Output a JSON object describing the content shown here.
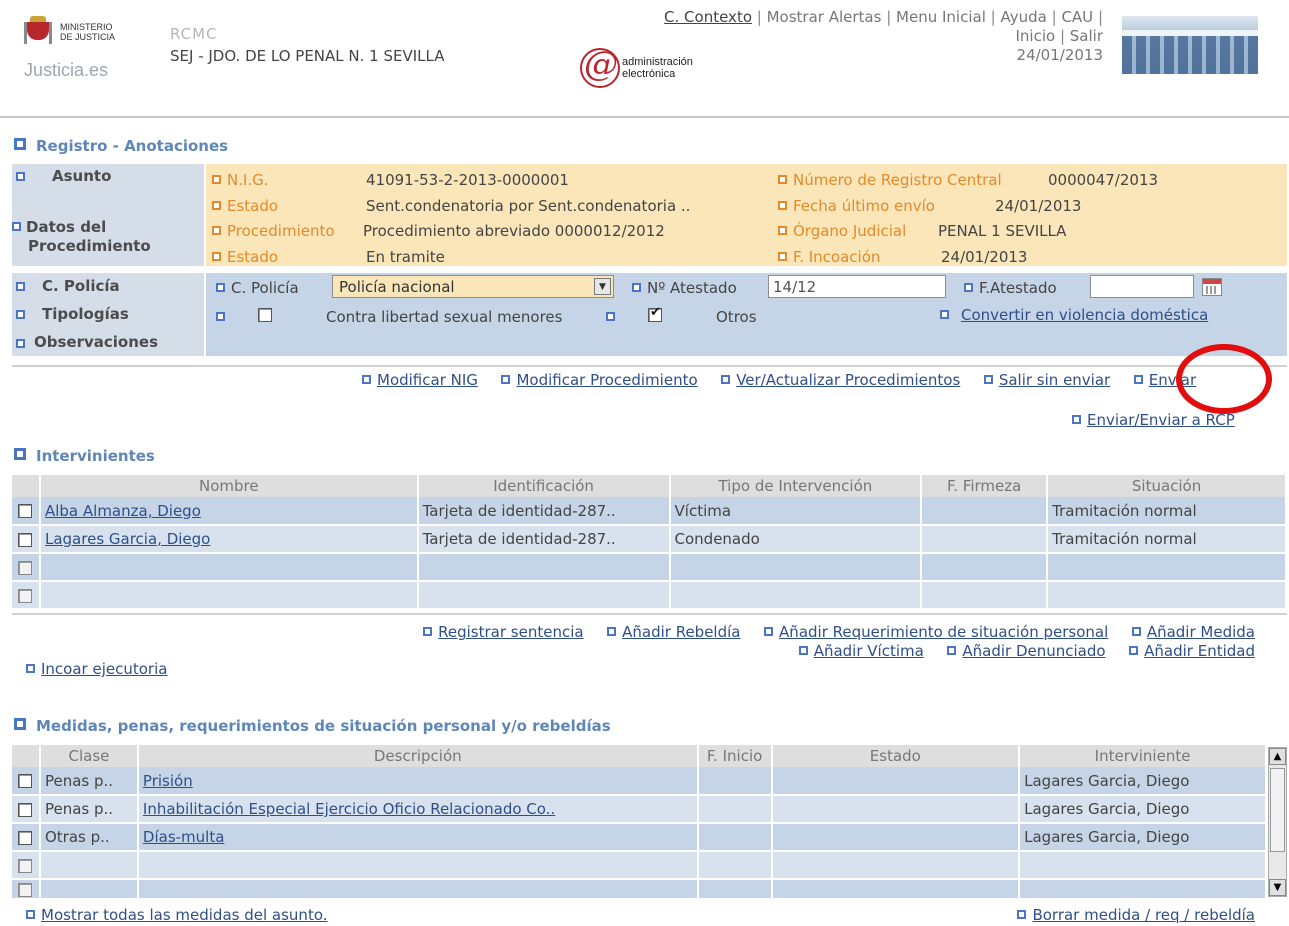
{
  "header": {
    "ministry_line1": "MINISTERIO",
    "ministry_line2": "DE JUSTICIA",
    "justicia_brand": "Justicia.es",
    "app_code": "RCMC",
    "court": "SEJ - JDO. DE LO PENAL N. 1 SEVILLA",
    "ae_line1": "administración",
    "ae_line2": "electrónica",
    "nav": {
      "contexto": "C. Contexto",
      "alertas": "Mostrar Alertas",
      "menu": "Menu Inicial",
      "ayuda": "Ayuda",
      "cau": "CAU",
      "inicio": "Inicio",
      "salir": "Salir",
      "date": "24/01/2013"
    }
  },
  "registro": {
    "title": "Registro - Anotaciones",
    "asunto_label": "Asunto",
    "datos_label_1": "Datos del",
    "datos_label_2": "Procedimiento",
    "nig_label": "N.I.G.",
    "nig_value": "41091-53-2-2013-0000001",
    "estado1_label": "Estado",
    "estado1_value": "Sent.condenatoria por Sent.condenatoria ..",
    "proc_label": "Procedimiento",
    "proc_value": "Procedimiento abreviado 0000012/2012",
    "estado2_label": "Estado",
    "estado2_value": "En tramite",
    "nrc_label": "Número de Registro Central",
    "nrc_value": "0000047/2013",
    "fue_label": "Fecha último envío",
    "fue_value": "24/01/2013",
    "organo_label": "Órgano Judicial",
    "organo_value": "PENAL 1 SEVILLA",
    "fincoacion_label": "F. Incoación",
    "fincoacion_value": "24/01/2013",
    "cpolicia_row_label": "C. Policía",
    "cpolicia_field_label": "C. Policía",
    "cpolicia_selected": "Policía nacional",
    "atestado_label": "Nº Atestado",
    "atestado_value": "14/12",
    "fatestado_label": "F.Atestado",
    "tipologias_label": "Tipologías",
    "tip1_text": "Contra libertad sexual menores",
    "tip2_text": "Otros",
    "convertir_link": "Convertir en violencia doméstica",
    "observaciones_label": "Observaciones"
  },
  "actions1": {
    "modificar_nig": "Modificar NIG",
    "modificar_proc": "Modificar Procedimiento",
    "ver_actualizar": "Ver/Actualizar Procedimientos",
    "salir_sin_enviar": "Salir sin enviar",
    "enviar": "Enviar",
    "enviar_rcp": "Enviar/Enviar a RCP"
  },
  "intervinientes": {
    "title": "Intervinientes",
    "columns": [
      "Nombre",
      "Identificación",
      "Tipo de Intervención",
      "F. Firmeza",
      "Situación"
    ],
    "rows": [
      {
        "nombre": "Alba Almanza, Diego",
        "ident": "Tarjeta de identidad-287..",
        "tipo": "Víctima",
        "firmeza": "",
        "situacion": "Tramitación normal"
      },
      {
        "nombre": "Lagares Garcia, Diego",
        "ident": "Tarjeta de identidad-287..",
        "tipo": "Condenado",
        "firmeza": "",
        "situacion": "Tramitación normal"
      }
    ]
  },
  "actions2": {
    "registrar_sentencia": "Registrar sentencia",
    "anadir_rebeldia": "Añadir Rebeldía",
    "anadir_requerimiento": "Añadir Requerimiento de situación personal",
    "anadir_medida": "Añadir Medida",
    "anadir_victima": "Añadir Víctima",
    "anadir_denunciado": "Añadir Denunciado",
    "anadir_entidad": "Añadir Entidad",
    "incoar_ejecutoria": "Incoar ejecutoria"
  },
  "medidas": {
    "title": "Medidas, penas, requerimientos de situación personal y/o rebeldías",
    "columns": [
      "Clase",
      "Descripción",
      "F. Inicio",
      "Estado",
      "Interviniente"
    ],
    "rows": [
      {
        "clase": "Penas p..",
        "desc": "Prisión",
        "inicio": "",
        "estado": "",
        "interv": "Lagares Garcia, Diego"
      },
      {
        "clase": "Penas p..",
        "desc": "Inhabilitación Especial Ejercicio Oficio Relacionado Co..",
        "inicio": "",
        "estado": "",
        "interv": "Lagares Garcia, Diego"
      },
      {
        "clase": "Otras p..",
        "desc": "Días-multa",
        "inicio": "",
        "estado": "",
        "interv": "Lagares Garcia, Diego"
      }
    ],
    "mostrar_todas": "Mostrar todas las medidas del asunto.",
    "borrar": "Borrar medida / req / rebeldía"
  },
  "colors": {
    "accent_blue": "#5e87b8",
    "info_bg": "#fbe6ba",
    "label_orange": "#e38a2a",
    "row_blue": "#c5d4e6",
    "highlight_red": "#e20d0d"
  }
}
